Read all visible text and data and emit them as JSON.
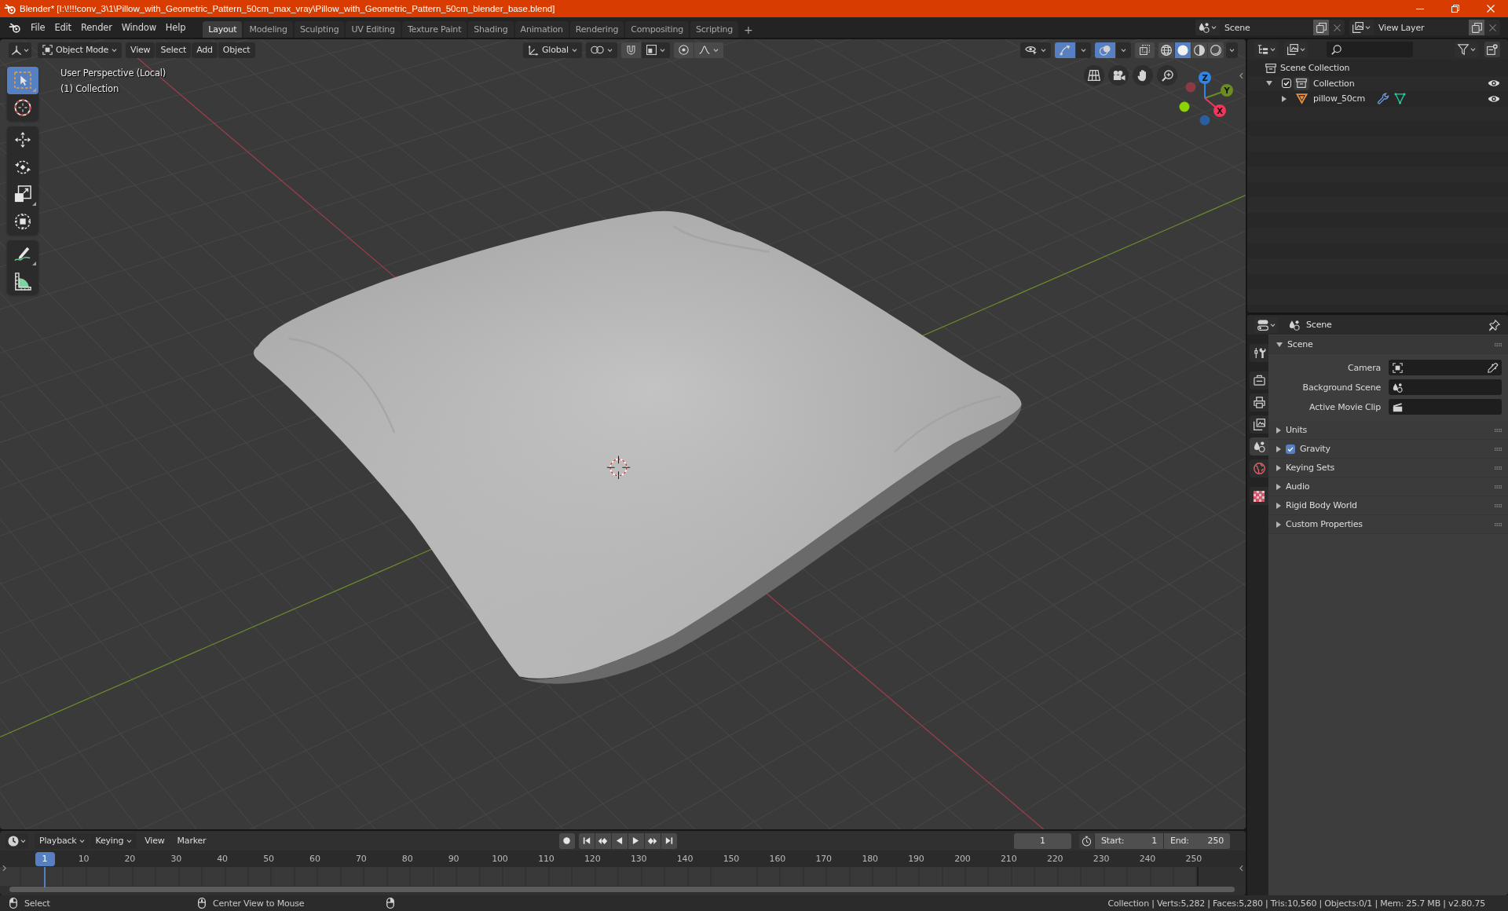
{
  "window": {
    "title": "Blender* [I:\\!!!!conv_3\\1\\Pillow_with_Geometric_Pattern_50cm_max_vray\\Pillow_with_Geometric_Pattern_50cm_blender_base.blend]"
  },
  "menu": [
    "File",
    "Edit",
    "Render",
    "Window",
    "Help"
  ],
  "workspaces": [
    {
      "label": "Layout",
      "selected": true
    },
    {
      "label": "Modeling",
      "selected": false
    },
    {
      "label": "Sculpting",
      "selected": false
    },
    {
      "label": "UV Editing",
      "selected": false
    },
    {
      "label": "Texture Paint",
      "selected": false
    },
    {
      "label": "Shading",
      "selected": false
    },
    {
      "label": "Animation",
      "selected": false
    },
    {
      "label": "Rendering",
      "selected": false
    },
    {
      "label": "Compositing",
      "selected": false
    },
    {
      "label": "Scripting",
      "selected": false
    }
  ],
  "add_workspace": "+",
  "scene": {
    "value": "Scene"
  },
  "view_layer": {
    "value": "View Layer"
  },
  "viewport": {
    "mode": "Object Mode",
    "menus": [
      "View",
      "Select",
      "Add",
      "Object"
    ],
    "orientation": "Global",
    "snapping": false,
    "proportional_editing": false,
    "show_gizmos": true,
    "show_overlays": true,
    "xray": false,
    "shading": [
      {
        "kind": "wireframe",
        "selected": false
      },
      {
        "kind": "solid",
        "selected": true
      },
      {
        "kind": "material",
        "selected": false
      },
      {
        "kind": "rendered",
        "selected": false
      }
    ],
    "info": [
      "User Perspective (Local)",
      "(1) Collection"
    ],
    "toolbar": [
      {
        "tools": [
          {
            "kind": "select-box",
            "selected": true,
            "submenu": true
          },
          {
            "kind": "cursor",
            "selected": false,
            "submenu": false
          }
        ]
      },
      {
        "tools": [
          {
            "kind": "move",
            "selected": false,
            "submenu": false
          },
          {
            "kind": "rotate",
            "selected": false,
            "submenu": false
          },
          {
            "kind": "scale",
            "selected": false,
            "submenu": true
          },
          {
            "kind": "transform",
            "selected": false,
            "submenu": false
          }
        ]
      },
      {
        "tools": [
          {
            "kind": "annotate",
            "selected": false,
            "submenu": true
          },
          {
            "kind": "measure",
            "selected": false,
            "submenu": false
          }
        ]
      }
    ],
    "axes": [
      {
        "label": "X",
        "color": "#f0365a"
      },
      {
        "label": "Y",
        "color": "#6b8c23"
      },
      {
        "label": "Z",
        "color": "#2f86e6"
      }
    ]
  },
  "outliner": {
    "tree": [
      {
        "kind": "scene-collection",
        "label": "Scene Collection",
        "children": [
          {
            "kind": "collection",
            "label": "Collection",
            "expanded": true,
            "checked": true,
            "visible": true,
            "children": [
              {
                "kind": "mesh-object",
                "label": "pillow_50cm",
                "expanded": false,
                "visible": true
              }
            ]
          }
        ]
      }
    ]
  },
  "properties": {
    "title": "Scene",
    "tab_groups": [
      {
        "tabs": [
          {
            "kind": "tool",
            "selected": false
          }
        ]
      },
      {
        "tabs": [
          {
            "kind": "render",
            "selected": false
          },
          {
            "kind": "output",
            "selected": false
          },
          {
            "kind": "view-layer",
            "selected": false
          },
          {
            "kind": "scene",
            "selected": true
          },
          {
            "kind": "world",
            "selected": false
          }
        ]
      },
      {
        "tabs": [
          {
            "kind": "texture",
            "selected": false
          }
        ]
      }
    ],
    "panels": [
      {
        "title": "Scene",
        "expanded": true,
        "fields": [
          {
            "label": "Camera",
            "kind": "object"
          },
          {
            "label": "Background Scene",
            "kind": "scene"
          },
          {
            "label": "Active Movie Clip",
            "kind": "clip"
          }
        ]
      },
      {
        "title": "Units",
        "expanded": false
      },
      {
        "title": "Gravity",
        "expanded": false,
        "checked": true
      },
      {
        "title": "Keying Sets",
        "expanded": false
      },
      {
        "title": "Audio",
        "expanded": false
      },
      {
        "title": "Rigid Body World",
        "expanded": false
      },
      {
        "title": "Custom Properties",
        "expanded": false
      }
    ]
  },
  "timeline": {
    "menus": [
      {
        "label": "Playback",
        "kind": "dropdown"
      },
      {
        "label": "Keying",
        "kind": "dropdown"
      },
      {
        "label": "View",
        "kind": "menu"
      },
      {
        "label": "Marker",
        "kind": "menu"
      }
    ],
    "current_frame": "1",
    "start": {
      "label": "Start:",
      "value": "1"
    },
    "end": {
      "label": "End:",
      "value": "250"
    },
    "ruler": [
      {
        "label": "1",
        "selected": true
      },
      {
        "label": "10",
        "selected": false
      },
      {
        "label": "20",
        "selected": false
      },
      {
        "label": "30",
        "selected": false
      },
      {
        "label": "40",
        "selected": false
      },
      {
        "label": "50",
        "selected": false
      },
      {
        "label": "60",
        "selected": false
      },
      {
        "label": "70",
        "selected": false
      },
      {
        "label": "80",
        "selected": false
      },
      {
        "label": "90",
        "selected": false
      },
      {
        "label": "100",
        "selected": false
      },
      {
        "label": "110",
        "selected": false
      },
      {
        "label": "120",
        "selected": false
      },
      {
        "label": "130",
        "selected": false
      },
      {
        "label": "140",
        "selected": false
      },
      {
        "label": "150",
        "selected": false
      },
      {
        "label": "160",
        "selected": false
      },
      {
        "label": "170",
        "selected": false
      },
      {
        "label": "180",
        "selected": false
      },
      {
        "label": "190",
        "selected": false
      },
      {
        "label": "200",
        "selected": false
      },
      {
        "label": "210",
        "selected": false
      },
      {
        "label": "220",
        "selected": false
      },
      {
        "label": "230",
        "selected": false
      },
      {
        "label": "240",
        "selected": false
      },
      {
        "label": "250",
        "selected": false
      }
    ]
  },
  "status_bar": {
    "hints": [
      {
        "kind": "left",
        "label": "Select"
      },
      {
        "kind": "middle",
        "label": "Center View to Mouse"
      },
      {
        "kind": "right"
      }
    ],
    "stats": "Collection | Verts:5,282 | Faces:5,280 | Tris:10,560 | Objects:0/1 | Mem: 25.7 MB | v2.80.75"
  }
}
